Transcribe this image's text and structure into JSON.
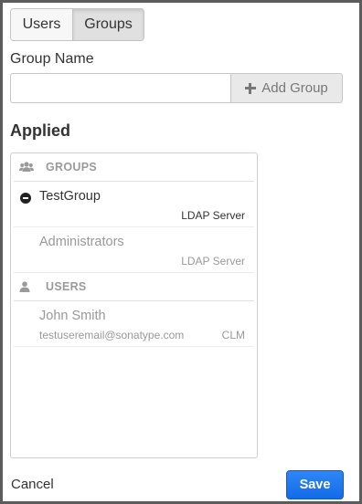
{
  "tabs": {
    "users_label": "Users",
    "groups_label": "Groups",
    "selected": "Groups"
  },
  "form": {
    "label": "Group Name",
    "input_value": "",
    "input_placeholder": "",
    "add_button_label": "Add Group"
  },
  "applied": {
    "heading": "Applied",
    "groups_header": "GROUPS",
    "groups": [
      {
        "name": "TestGroup",
        "source": "LDAP Server",
        "removable": true
      },
      {
        "name": "Administrators",
        "source": "LDAP Server",
        "removable": false
      }
    ],
    "users_header": "USERS",
    "users": [
      {
        "name": "John Smith",
        "email": "testuseremail@sonatype.com",
        "source": "CLM"
      }
    ]
  },
  "footer": {
    "cancel_label": "Cancel",
    "save_label": "Save"
  },
  "colors": {
    "accent": "#1a73ef",
    "frame_border": "#5c5c5c",
    "muted_text": "#999999"
  },
  "icons": {
    "groups_header_icon": "group-icon",
    "users_header_icon": "user-icon",
    "remove_icon": "minus-circle-icon",
    "add_icon": "plus-icon"
  }
}
